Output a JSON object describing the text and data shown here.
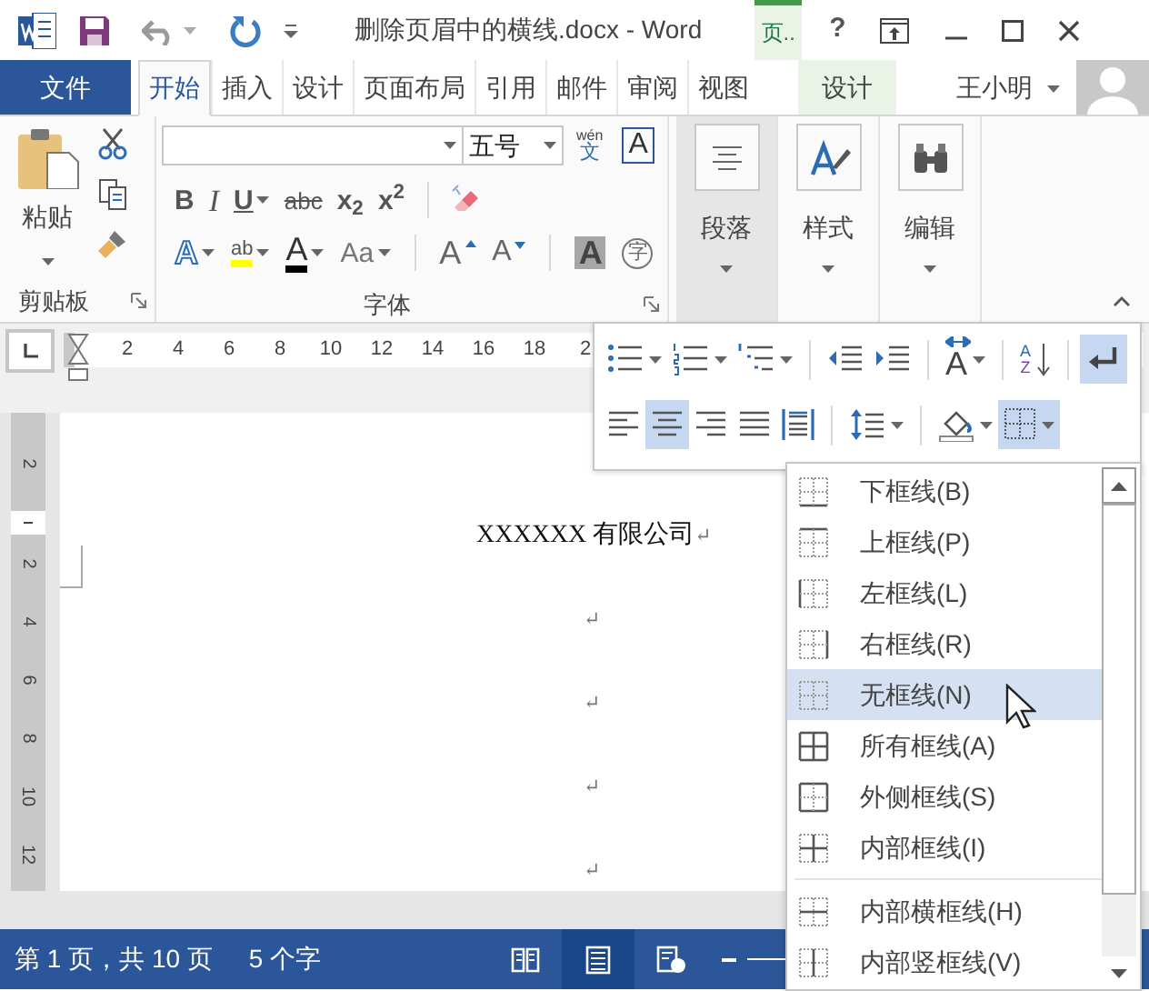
{
  "title_bar": {
    "title": "删除页眉中的横线.docx - Word",
    "contextual_group": "页..",
    "help": "?"
  },
  "ribbon_tabs": [
    {
      "label": "文件",
      "kind": "file",
      "selected": false
    },
    {
      "label": "开始",
      "kind": "normal",
      "selected": true
    },
    {
      "label": "插入",
      "kind": "normal",
      "selected": false
    },
    {
      "label": "设计",
      "kind": "normal",
      "selected": false
    },
    {
      "label": "页面布局",
      "kind": "normal",
      "selected": false
    },
    {
      "label": "引用",
      "kind": "normal",
      "selected": false
    },
    {
      "label": "邮件",
      "kind": "normal",
      "selected": false
    },
    {
      "label": "审阅",
      "kind": "normal",
      "selected": false
    },
    {
      "label": "视图",
      "kind": "normal",
      "selected": false
    },
    {
      "label": "设计",
      "kind": "contextual",
      "selected": false
    }
  ],
  "user": {
    "name": "王小明"
  },
  "clipboard": {
    "paste_label": "粘贴",
    "group_label": "剪贴板"
  },
  "font": {
    "font_size": "五号",
    "phonetic_top": "wén",
    "phonetic_char": "文",
    "char_border": "A",
    "group_label": "字体",
    "format_buttons": [
      {
        "kind": "bold",
        "label": "B",
        "dropdown": false
      },
      {
        "kind": "italic",
        "label": "I",
        "dropdown": false
      },
      {
        "kind": "underline",
        "label": "U",
        "dropdown": true
      },
      {
        "kind": "strike",
        "label": "abc",
        "dropdown": false
      },
      {
        "kind": "subscript",
        "label": "x$_{2}$",
        "dropdown": false
      },
      {
        "kind": "superscript",
        "label": "x$^{2}$",
        "dropdown": false
      }
    ],
    "effect_buttons": [
      {
        "kind": "text_effect",
        "label": "A",
        "dropdown": true
      },
      {
        "kind": "highlight",
        "label": "ab",
        "dropdown": true
      },
      {
        "kind": "font_color",
        "label": "A",
        "dropdown": true
      },
      {
        "kind": "change_case",
        "label": "Aa",
        "dropdown": true
      },
      {
        "kind": "grow",
        "label": "A",
        "dropdown": false
      },
      {
        "kind": "shrink",
        "label": "A",
        "dropdown": false
      },
      {
        "kind": "shading",
        "label": "A",
        "dropdown": false
      },
      {
        "kind": "enclose",
        "label": "字",
        "dropdown": false
      }
    ]
  },
  "large_buttons": [
    {
      "label": "段落",
      "kind": "paragraph",
      "selected": true
    },
    {
      "label": "样式",
      "kind": "styles",
      "selected": false
    },
    {
      "label": "编辑",
      "kind": "editing",
      "selected": false
    }
  ],
  "ruler": {
    "numbers": [
      "2",
      "4",
      "6",
      "8",
      "10",
      "12",
      "14",
      "16",
      "18",
      "2"
    ]
  },
  "vertical_ruler": {
    "top_number": "2",
    "numbers": [
      "2",
      "4",
      "6",
      "8",
      "10",
      "12"
    ]
  },
  "document": {
    "paragraphs": [
      {
        "text": "XXXXXX 有限公司",
        "mark": "↵"
      },
      {
        "mark": "↵"
      },
      {
        "mark": "↵"
      },
      {
        "mark": "↵"
      },
      {
        "mark": "↵"
      }
    ]
  },
  "status_bar": {
    "page": "第 1 页，共 10 页",
    "words": "5 个字",
    "views": [
      {
        "kind": "read",
        "selected": false
      },
      {
        "kind": "print",
        "selected": true
      },
      {
        "kind": "web",
        "selected": false
      }
    ]
  },
  "paragraph_panel": {
    "rows": [
      [
        {
          "kind": "bullets",
          "dropdown": true,
          "selected": false
        },
        {
          "kind": "numbering",
          "dropdown": true,
          "selected": false
        },
        {
          "kind": "multilevel",
          "dropdown": true,
          "selected": false
        },
        {
          "kind": "sep"
        },
        {
          "kind": "outdent",
          "dropdown": false,
          "selected": false
        },
        {
          "kind": "indent",
          "dropdown": false,
          "selected": false
        },
        {
          "kind": "sep"
        },
        {
          "kind": "text_direction",
          "label": "A",
          "dropdown": true,
          "selected": false
        },
        {
          "kind": "sep"
        },
        {
          "kind": "sort",
          "label": "A",
          "label2": "Z",
          "dropdown": false,
          "selected": false
        },
        {
          "kind": "sep"
        },
        {
          "kind": "show_marks",
          "dropdown": false,
          "selected": true
        }
      ],
      [
        {
          "kind": "align_left",
          "dropdown": false,
          "selected": false
        },
        {
          "kind": "align_center",
          "dropdown": false,
          "selected": true
        },
        {
          "kind": "align_right",
          "dropdown": false,
          "selected": false
        },
        {
          "kind": "justify",
          "dropdown": false,
          "selected": false
        },
        {
          "kind": "distribute",
          "dropdown": false,
          "selected": false
        },
        {
          "kind": "sep"
        },
        {
          "kind": "line_spacing",
          "dropdown": true,
          "selected": false
        },
        {
          "kind": "sep"
        },
        {
          "kind": "fill",
          "dropdown": true,
          "selected": false
        },
        {
          "kind": "borders",
          "dropdown": true,
          "selected": true
        }
      ]
    ]
  },
  "borders_menu": {
    "sections": [
      [
        {
          "label": "下框线(B)",
          "kind": "bottom",
          "selected": false
        },
        {
          "label": "上框线(P)",
          "kind": "top",
          "selected": false
        },
        {
          "label": "左框线(L)",
          "kind": "left",
          "selected": false
        },
        {
          "label": "右框线(R)",
          "kind": "right",
          "selected": false
        },
        {
          "label": "无框线(N)",
          "kind": "none",
          "selected": true
        },
        {
          "label": "所有框线(A)",
          "kind": "all",
          "selected": false
        },
        {
          "label": "外侧框线(S)",
          "kind": "outside",
          "selected": false
        },
        {
          "label": "内部框线(I)",
          "kind": "inside",
          "selected": false
        }
      ],
      [
        {
          "label": "内部横框线(H)",
          "kind": "inside_h",
          "selected": false
        },
        {
          "label": "内部竖框线(V)",
          "kind": "inside_v",
          "selected": false
        }
      ]
    ]
  }
}
